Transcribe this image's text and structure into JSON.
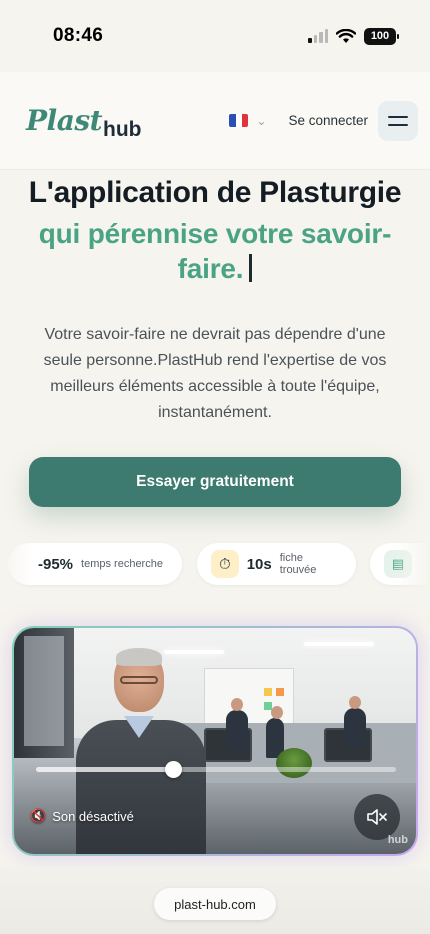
{
  "status": {
    "time": "08:46",
    "battery": "100"
  },
  "header": {
    "logo_part1": "Plast",
    "logo_part2": "hub",
    "language_flag": "french-flag",
    "login_label": "Se connecter"
  },
  "hero": {
    "title": "L'application de Plasturgie",
    "subtitle": "qui pérennise votre savoir-faire.",
    "description": "Votre savoir-faire ne devrait pas dépendre d'une seule personne.PlastHub rend l'expertise de vos meilleurs éléments accessible à toute l'équipe, instantanément.",
    "cta_label": "Essayer gratuitement"
  },
  "stats": [
    {
      "value": "-95%",
      "label": "temps recherche",
      "icon": ""
    },
    {
      "value": "10s",
      "label": "fiche trouvée",
      "icon": "stopwatch-icon"
    },
    {
      "value": "",
      "label": "",
      "icon": "document-icon"
    }
  ],
  "video": {
    "progress": 0.38,
    "sound_label": "Son désactivé",
    "mute_icon": "speaker-muted-icon",
    "watermark": "hub"
  },
  "browser": {
    "url": "plast-hub.com"
  },
  "colors": {
    "accent_green": "#4aa385",
    "cta": "#3d7a6f",
    "logo_green": "#3f8878"
  }
}
